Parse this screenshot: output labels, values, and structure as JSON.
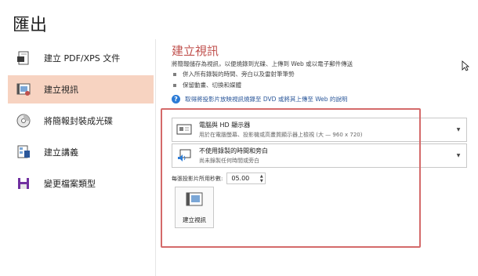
{
  "page": {
    "title": "匯出"
  },
  "sidebar": {
    "items": [
      {
        "label": "建立 PDF/XPS 文件",
        "icon": "pdf-document-icon"
      },
      {
        "label": "建立視訊",
        "icon": "create-video-icon",
        "active": true
      },
      {
        "label": "將簡報封裝成光碟",
        "icon": "cd-package-icon"
      },
      {
        "label": "建立講義",
        "icon": "handouts-icon"
      },
      {
        "label": "變更檔案類型",
        "icon": "change-file-type-icon"
      }
    ]
  },
  "main": {
    "heading": "建立視訊",
    "description": "將簡報儲存為視訊，以便燒錄到光碟、上傳到 Web 或以電子郵件傳送",
    "bullets": [
      "併入所有錄製的時間、旁白以及雷射筆筆勢",
      "保留動畫、切換和媒體"
    ],
    "help_link": "取得將投影片放映視訊燒錄至 DVD 或將其上傳至 Web 的說明",
    "quality_dropdown": {
      "title": "電腦與 HD 顯示器",
      "subtitle": "用於在電腦螢幕、投影機或高畫質顯示器上檢視 (大 — 960 x 720)",
      "icon": "monitor-icon"
    },
    "timing_dropdown": {
      "title": "不使用錄製的時間和旁白",
      "subtitle": "尚未錄製任何時間或旁白",
      "icon": "narration-timing-icon"
    },
    "seconds": {
      "label": "每張投影片所用秒數:",
      "value": "05.00"
    },
    "create_button": {
      "label": "建立視訊",
      "icon": "create-video-icon"
    }
  },
  "colors": {
    "accent": "#c0504d",
    "active_bg": "#f7d3c1",
    "highlight_box": "#d46a6a",
    "link": "#2b579a"
  }
}
